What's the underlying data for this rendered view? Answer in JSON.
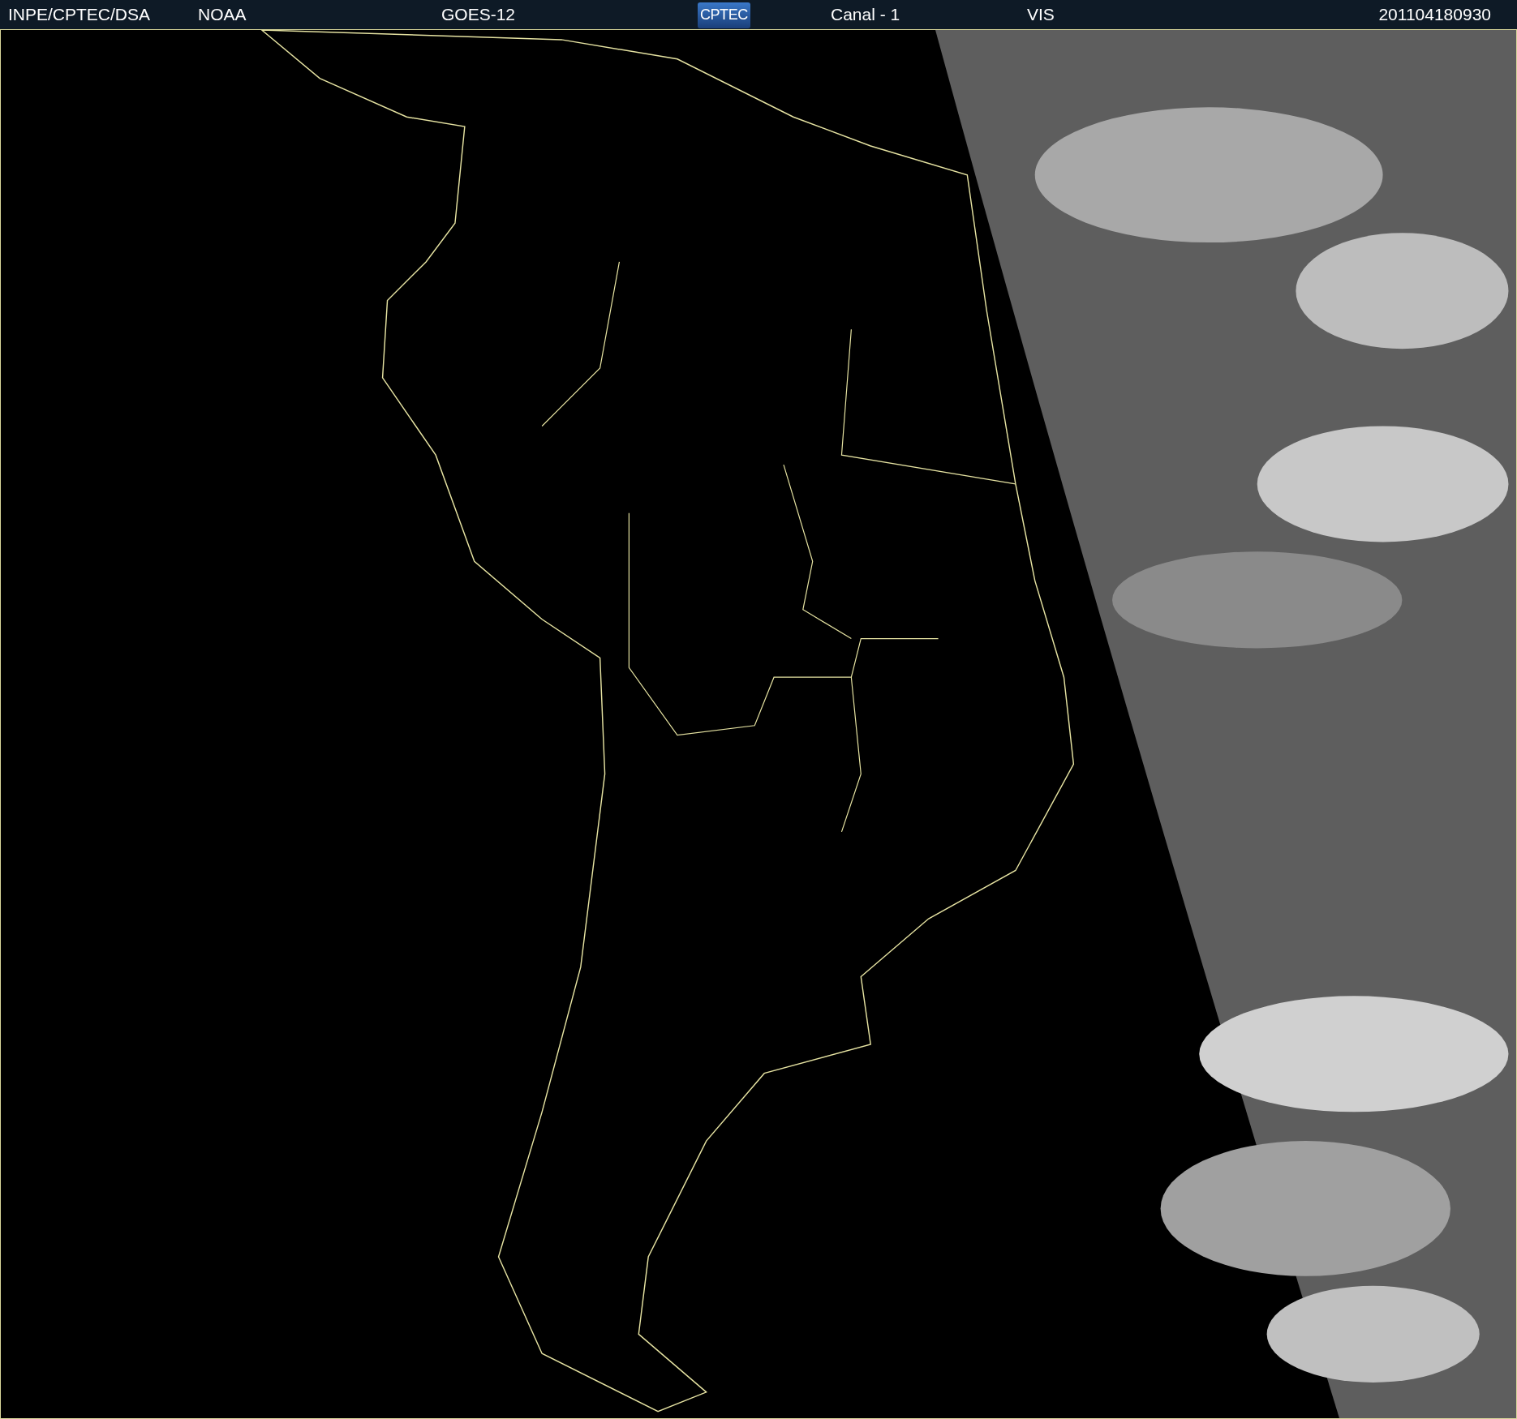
{
  "header": {
    "items": [
      {
        "kind": "text",
        "text": "INPE/CPTEC/DSA"
      },
      {
        "kind": "text",
        "text": "NOAA"
      },
      {
        "kind": "text",
        "text": "GOES-12"
      },
      {
        "kind": "logo",
        "text": "CPTEC"
      },
      {
        "kind": "text",
        "text": "Canal - 1"
      },
      {
        "kind": "text",
        "text": "VIS"
      },
      {
        "kind": "text",
        "text": "201104180930"
      }
    ]
  }
}
